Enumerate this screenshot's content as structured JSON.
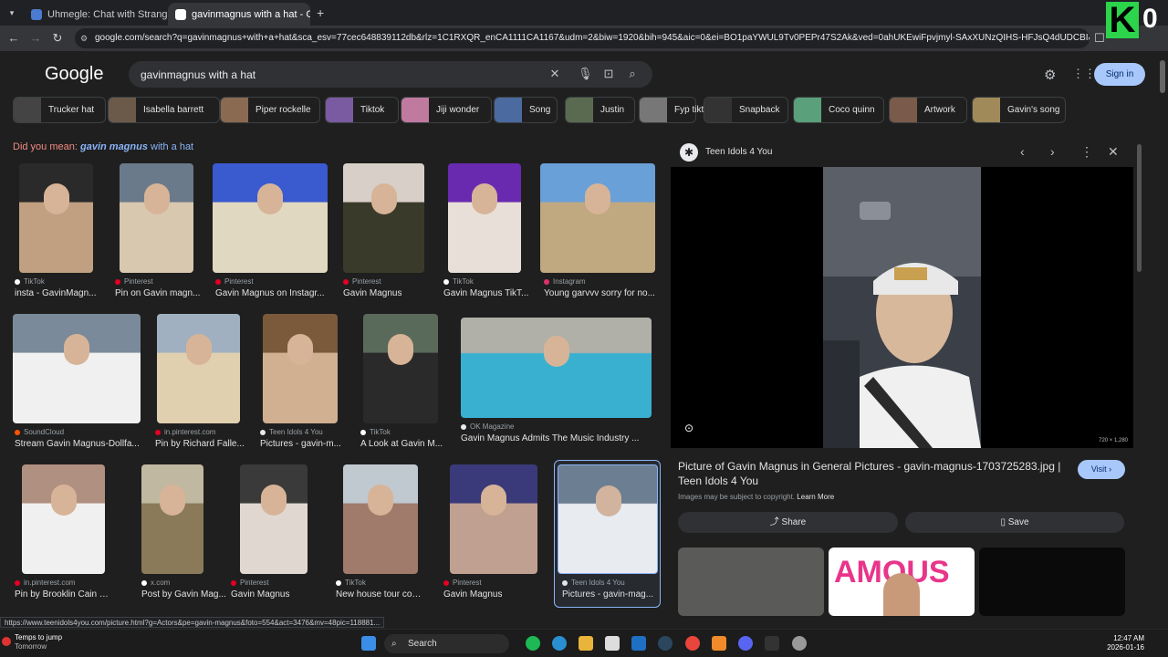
{
  "tabs": [
    {
      "label": "Uhmegle: Chat with Strangers",
      "fav_color": "#4a7bd0"
    },
    {
      "label": "gavinmagnus with a hat - Goog",
      "fav_color": "#ffffff"
    }
  ],
  "address": {
    "url": "google.com/search?q=gavinmagnus+with+a+hat&sca_esv=77cec648839112db&rlz=1C1RXQR_enCA1111CA1167&udm=2&biw=1920&bih=945&aic=0&ei=BO1paYWUL9Tv0PEPr47S2Ak&ved=0ahUKEwiFpvjmyl-SAxXUNzQIHS-HFJsQ4dUDCBI&uact=5&o..."
  },
  "overlay": {
    "badge_letter": "K",
    "count": "0"
  },
  "google": {
    "logo": "Google",
    "query": "gavinmagnus with a hat",
    "signin_label": "Sign in"
  },
  "chips": [
    {
      "label": "Trucker hat",
      "color": "#444"
    },
    {
      "label": "Isabella barrett",
      "color": "#6b5a4a"
    },
    {
      "label": "Piper rockelle",
      "color": "#8a6a50"
    },
    {
      "label": "Tiktok",
      "color": "#7a5aa0"
    },
    {
      "label": "Jiji wonder",
      "color": "#c07aa0"
    },
    {
      "label": "Song",
      "color": "#4a6aa0"
    },
    {
      "label": "Justin",
      "color": "#5a6a50"
    },
    {
      "label": "Fyp tiktok",
      "color": "#777"
    },
    {
      "label": "Snapback",
      "color": "#333"
    },
    {
      "label": "Coco quinn",
      "color": "#5aa07a"
    },
    {
      "label": "Artwork",
      "color": "#7a5a4a"
    },
    {
      "label": "Gavin's song",
      "color": "#a08a5a"
    }
  ],
  "did_you_mean": {
    "prefix": "Did you mean:",
    "link": "gavin magnus",
    "rest": "with a hat"
  },
  "results": [
    {
      "source": "TikTok",
      "title": "insta - GavinMagn...",
      "c1": "#2a2a2a",
      "c2": "#c0a080",
      "src_color": "#ffffff"
    },
    {
      "source": "Pinterest",
      "title": "Pin on Gavin magn...",
      "c1": "#6a7a8a",
      "c2": "#d8c8b0",
      "src_color": "#e60023"
    },
    {
      "source": "Pinterest",
      "title": "Gavin Magnus on Instagr...",
      "c1": "#3a5ad0",
      "c2": "#e0d8c0",
      "src_color": "#e60023"
    },
    {
      "source": "Pinterest",
      "title": "Gavin Magnus",
      "c1": "#d8d0c8",
      "c2": "#3a3a2a",
      "src_color": "#e60023"
    },
    {
      "source": "TikTok",
      "title": "Gavin Magnus TikT...",
      "c1": "#6a2ab0",
      "c2": "#e8e0d8",
      "src_color": "#ffffff"
    },
    {
      "source": "Instagram",
      "title": "Young garvvv sorry for no...",
      "c1": "#6aa0d8",
      "c2": "#c0a880",
      "src_color": "#e1306c"
    },
    {
      "source": "SoundCloud",
      "title": "Stream Gavin Magnus-Dollfa...",
      "c1": "#7a8a9a",
      "c2": "#f0f0f0",
      "src_color": "#ff5500"
    },
    {
      "source": "in.pinterest.com",
      "title": "Pin by Richard Falle...",
      "c1": "#a0b0c0",
      "c2": "#e0d0b0",
      "src_color": "#e60023"
    },
    {
      "source": "Teen Idols 4 You",
      "title": "Pictures - gavin-m...",
      "c1": "#7a5a3a",
      "c2": "#d0b090",
      "src_color": "#e8eaed"
    },
    {
      "source": "TikTok",
      "title": "A Look at Gavin M...",
      "c1": "#5a6a5a",
      "c2": "#2a2a2a",
      "src_color": "#ffffff"
    },
    {
      "source": "OK Magazine",
      "title": "Gavin Magnus Admits The Music Industry ...",
      "c1": "#b0b0a8",
      "c2": "#3ab0d0",
      "src_color": "#e8eaed"
    },
    {
      "source": "in.pinterest.com",
      "title": "Pin by Brooklin Cain o...",
      "c1": "#b09080",
      "c2": "#f0f0f0",
      "src_color": "#e60023"
    },
    {
      "source": "x.com",
      "title": "Post by Gavin Mag...",
      "c1": "#c0b8a0",
      "c2": "#8a7a5a",
      "src_color": "#ffffff"
    },
    {
      "source": "Pinterest",
      "title": "Gavin Magnus",
      "c1": "#3a3a3a",
      "c2": "#e0d8d0",
      "src_color": "#e60023"
    },
    {
      "source": "TikTok",
      "title": "New house tour comi...",
      "c1": "#c0c8d0",
      "c2": "#a07a6a",
      "src_color": "#ffffff"
    },
    {
      "source": "Pinterest",
      "title": "Gavin Magnus",
      "c1": "#3a3a7a",
      "c2": "#c0a090",
      "src_color": "#e60023"
    },
    {
      "source": "Teen Idols 4 You",
      "title": "Pictures - gavin-mag...",
      "c1": "#6a7a8a",
      "c2": "#f0f0f0",
      "src_color": "#e8eaed"
    }
  ],
  "panel": {
    "source": "Teen Idols 4 You",
    "logo_glyph": "✱",
    "dimensions": "720 × 1,280",
    "caption": "Picture of Gavin Magnus in General Pictures - gavin-magnus-1703725283.jpg | Teen Idols 4 You",
    "visit_label": "Visit",
    "copyright": "Images may be subject to copyright.",
    "learn_more": "Learn More",
    "share_label": "Share",
    "save_label": "Save"
  },
  "status_url": "https://www.teenidols4you.com/picture.html?g=Actors&pe=gavin-magnus&foto=554&act=3476&mv=48pic=118881...",
  "taskbar": {
    "weather_title": "Temps to jump",
    "weather_sub": "Tomorrow",
    "search_label": "Search",
    "time": "12:47 AM",
    "date": "2026-01-16"
  }
}
